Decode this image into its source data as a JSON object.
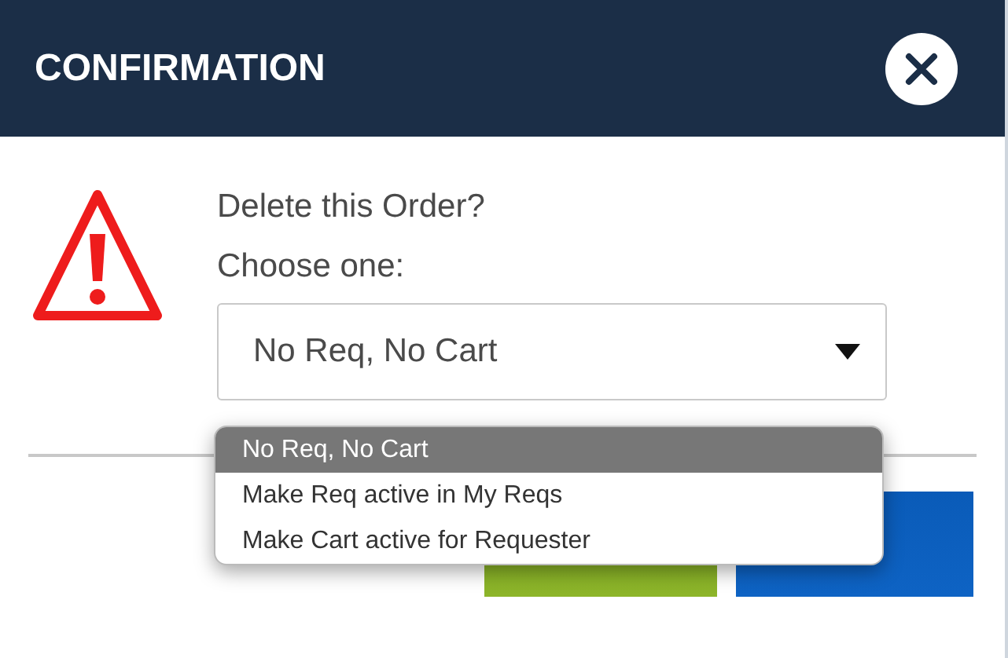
{
  "dialog": {
    "title": "CONFIRMATION",
    "message": "Delete this Order?",
    "prompt": "Choose one:",
    "select": {
      "value": "No Req, No Cart",
      "expanded": true,
      "options": [
        {
          "label": "No Req, No Cart",
          "selected": true
        },
        {
          "label": "Make Req active in My Reqs",
          "selected": false
        },
        {
          "label": "Make Cart active for Requester",
          "selected": false
        }
      ]
    },
    "buttons": [
      {
        "kind": "ok"
      },
      {
        "kind": "cancel"
      }
    ]
  }
}
